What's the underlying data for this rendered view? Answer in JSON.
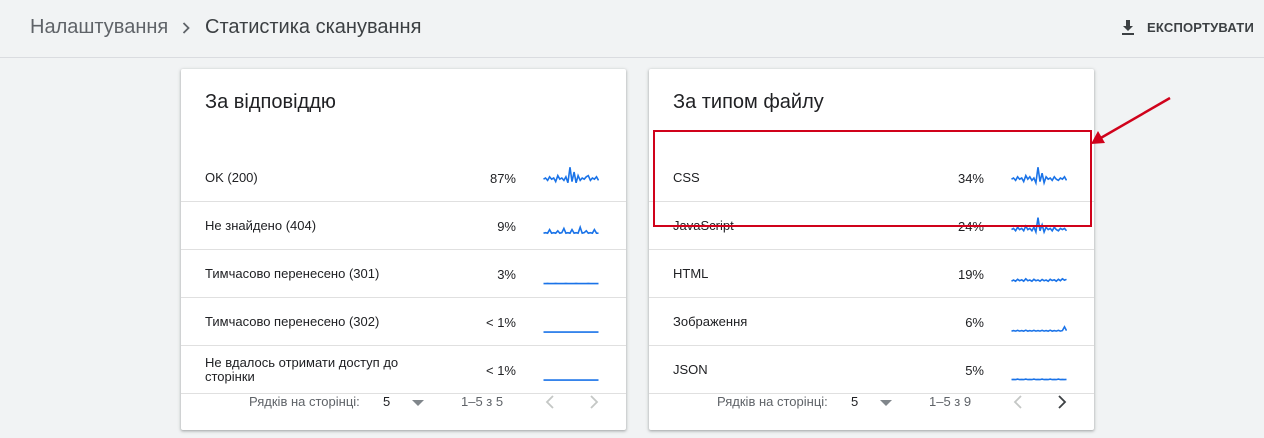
{
  "breadcrumb": {
    "root": "Налаштування",
    "current": "Статистика сканування"
  },
  "header": {
    "export_label": "ЕКСПОРТУВАТИ",
    "export_icon": "download-icon"
  },
  "colors": {
    "spark": "#1a73e8",
    "annotation": "#d0021b"
  },
  "cards": [
    {
      "title": "За відповіддю",
      "rows": [
        {
          "label": "OK (200)",
          "pct": "87%",
          "spark": [
            0.45,
            0.5,
            0.4,
            0.55,
            0.45,
            0.5,
            0.35,
            0.6,
            0.45,
            0.5,
            0.4,
            0.55,
            0.3,
            0.95,
            0.35,
            0.75,
            0.3,
            0.6,
            0.4,
            0.5,
            0.45,
            0.55,
            0.6,
            0.4,
            0.5,
            0.45,
            0.55,
            0.4
          ]
        },
        {
          "label": "Не знайдено (404)",
          "pct": "9%",
          "spark": [
            0.2,
            0.22,
            0.2,
            0.35,
            0.2,
            0.22,
            0.2,
            0.3,
            0.2,
            0.22,
            0.4,
            0.2,
            0.22,
            0.2,
            0.35,
            0.2,
            0.22,
            0.2,
            0.45,
            0.2,
            0.22,
            0.3,
            0.2,
            0.22,
            0.2,
            0.35,
            0.2,
            0.2
          ]
        },
        {
          "label": "Тимчасово перенесено (301)",
          "pct": "3%",
          "spark": [
            0.1,
            0.1,
            0.11,
            0.1,
            0.1,
            0.1,
            0.11,
            0.1,
            0.1,
            0.1,
            0.1,
            0.11,
            0.1,
            0.1,
            0.1,
            0.1,
            0.11,
            0.1,
            0.1,
            0.1,
            0.1,
            0.1,
            0.11,
            0.1,
            0.1,
            0.1,
            0.1,
            0.1
          ]
        },
        {
          "label": "Тимчасово перенесено (302)",
          "pct": "< 1%",
          "spark": [
            0.08,
            0.08,
            0.08,
            0.08,
            0.08,
            0.08,
            0.08,
            0.08,
            0.08,
            0.08,
            0.08,
            0.08,
            0.08,
            0.08,
            0.08,
            0.08,
            0.08,
            0.08,
            0.08,
            0.08,
            0.08,
            0.08,
            0.08,
            0.08,
            0.08,
            0.08,
            0.08,
            0.08
          ]
        },
        {
          "label": "Не вдалось отримати доступ до сторінки",
          "pct": "< 1%",
          "spark": [
            0.08,
            0.08,
            0.08,
            0.08,
            0.08,
            0.08,
            0.08,
            0.08,
            0.08,
            0.08,
            0.08,
            0.08,
            0.08,
            0.08,
            0.08,
            0.08,
            0.08,
            0.08,
            0.08,
            0.08,
            0.08,
            0.08,
            0.08,
            0.08,
            0.08,
            0.08,
            0.08,
            0.08
          ]
        }
      ],
      "footer": {
        "rows_per_page_label": "Рядків на сторінці:",
        "rows_per_page": "5",
        "range": "1–5 з 5",
        "prev_enabled": false,
        "next_enabled": false
      }
    },
    {
      "title": "За типом файлу",
      "rows": [
        {
          "label": "CSS",
          "pct": "34%",
          "spark": [
            0.45,
            0.5,
            0.4,
            0.55,
            0.45,
            0.5,
            0.35,
            0.6,
            0.45,
            0.55,
            0.4,
            0.5,
            0.3,
            0.95,
            0.35,
            0.7,
            0.3,
            0.55,
            0.45,
            0.5,
            0.4,
            0.55,
            0.45,
            0.4,
            0.5,
            0.45,
            0.55,
            0.4
          ]
        },
        {
          "label": "JavaScript",
          "pct": "24%",
          "spark": [
            0.35,
            0.4,
            0.3,
            0.45,
            0.35,
            0.4,
            0.3,
            0.5,
            0.35,
            0.4,
            0.3,
            0.45,
            0.25,
            0.85,
            0.3,
            0.55,
            0.25,
            0.45,
            0.35,
            0.4,
            0.3,
            0.45,
            0.35,
            0.3,
            0.4,
            0.35,
            0.4,
            0.3
          ]
        },
        {
          "label": "HTML",
          "pct": "19%",
          "spark": [
            0.2,
            0.25,
            0.2,
            0.28,
            0.22,
            0.26,
            0.2,
            0.3,
            0.22,
            0.25,
            0.2,
            0.28,
            0.22,
            0.25,
            0.2,
            0.27,
            0.22,
            0.25,
            0.2,
            0.28,
            0.23,
            0.26,
            0.2,
            0.28,
            0.22,
            0.3,
            0.24,
            0.28
          ]
        },
        {
          "label": "Зображення",
          "pct": "6%",
          "spark": [
            0.12,
            0.14,
            0.12,
            0.15,
            0.12,
            0.14,
            0.12,
            0.16,
            0.12,
            0.14,
            0.12,
            0.15,
            0.12,
            0.14,
            0.12,
            0.15,
            0.12,
            0.14,
            0.12,
            0.16,
            0.12,
            0.14,
            0.12,
            0.15,
            0.12,
            0.14,
            0.3,
            0.14
          ]
        },
        {
          "label": "JSON",
          "pct": "5%",
          "spark": [
            0.1,
            0.11,
            0.1,
            0.12,
            0.1,
            0.11,
            0.1,
            0.12,
            0.1,
            0.11,
            0.1,
            0.12,
            0.1,
            0.11,
            0.1,
            0.12,
            0.1,
            0.11,
            0.1,
            0.12,
            0.1,
            0.11,
            0.1,
            0.12,
            0.1,
            0.11,
            0.1,
            0.11
          ]
        }
      ],
      "footer": {
        "rows_per_page_label": "Рядків на сторінці:",
        "rows_per_page": "5",
        "range": "1–5 з 9",
        "prev_enabled": false,
        "next_enabled": true
      }
    }
  ]
}
